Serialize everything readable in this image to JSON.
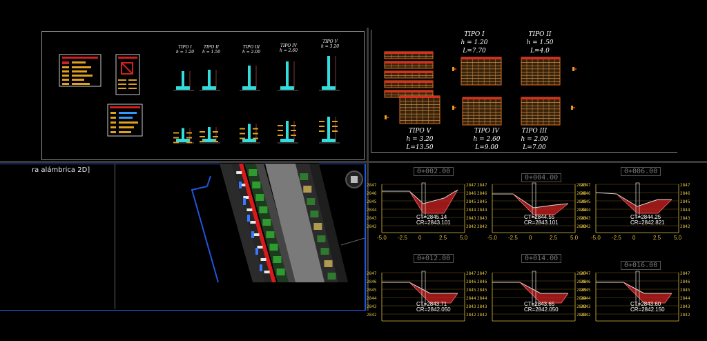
{
  "viewport_label": "ra alámbrica 2D]",
  "wall_types": {
    "small_titles": [
      "TIPO I",
      "TIPO II",
      "TIPO III",
      "TIPO IV",
      "TIPO V"
    ],
    "small_heights": [
      "h = 1.20",
      "h = 1.50",
      "h = 2.00",
      "h = 2.60",
      "h = 3.20"
    ]
  },
  "tables": {
    "tipo1": {
      "title": "TIPO I",
      "h": "h = 1.20",
      "l": "L=7.70"
    },
    "tipo2": {
      "title": "TIPO II",
      "h": "h = 1.50",
      "l": "L=4.0"
    },
    "tipo5": {
      "title": "TIPO V",
      "h": "h = 3.20",
      "l": "L=13.50"
    },
    "tipo4": {
      "title": "TIPO IV",
      "h": "h = 2.60",
      "l": "L=9.00"
    },
    "tipo3": {
      "title": "TIPO III",
      "h": "h = 2.00",
      "l": "L=7.00"
    }
  },
  "sections": [
    {
      "station": "0+002.00",
      "ct": "CT=2845.14",
      "cr": "CR=2843.101"
    },
    {
      "station": "0+004.00",
      "ct": "CT=2844.55",
      "cr": "CR=2843.101"
    },
    {
      "station": "0+006.00",
      "ct": "CT=2844.25",
      "cr": "CR=2842.821"
    },
    {
      "station": "0+012.00",
      "ct": "CT=2843.71",
      "cr": "CR=2842.050"
    },
    {
      "station": "0+014.00",
      "ct": "CT=2843.65",
      "cr": "CR=2842.050"
    },
    {
      "station": "0+016.00",
      "ct": "CT=2843.60",
      "cr": "CR=2842.150"
    }
  ],
  "section_y_ticks_top": [
    "2847",
    "2846",
    "2845",
    "2844",
    "2843",
    "2842"
  ],
  "section_y_ticks_bottom": [
    "2847",
    "2846",
    "2845",
    "2844",
    "2843",
    "2842"
  ],
  "section_x_ticks": [
    "-5.0",
    "-2.5",
    "0",
    "2.5",
    "5.0"
  ],
  "colors": {
    "accent_blue": "#2255dd",
    "fill_red": "#cc2222",
    "axis_yellow": "#e0c040",
    "cyan": "#33dddd"
  }
}
